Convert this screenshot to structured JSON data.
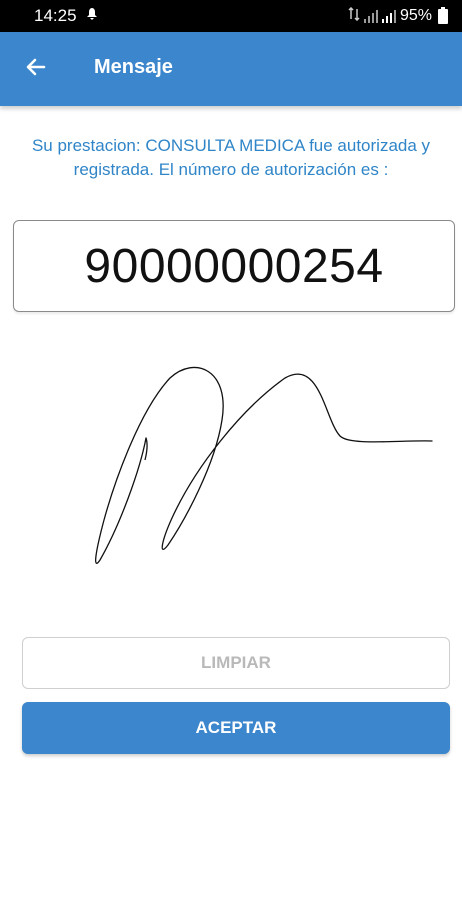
{
  "status_bar": {
    "time": "14:25",
    "battery": "95%",
    "icons": [
      "notification-icon",
      "data-arrows-icon",
      "signal-icon",
      "signal-icon",
      "battery-icon"
    ]
  },
  "app_bar": {
    "title": "Mensaje",
    "back_icon": "arrow-left-icon",
    "color": "#3b86cc"
  },
  "message": {
    "text": "Su prestacion: CONSULTA MEDICA fue autorizada y registrada. El número de autorización es :"
  },
  "authorization": {
    "number": "90000000254"
  },
  "signature": {
    "description_icon": "signature-drawing"
  },
  "buttons": {
    "clear_label": "LIMPIAR",
    "accept_label": "ACEPTAR"
  },
  "colors": {
    "accent": "#3b86cc",
    "message_text": "#2f85c8",
    "disabled_text": "#b9b9b9"
  }
}
